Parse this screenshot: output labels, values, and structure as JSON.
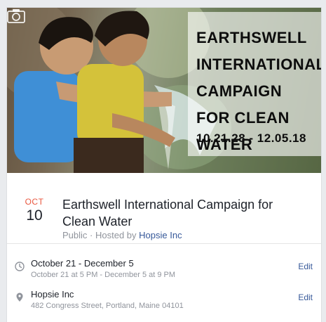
{
  "cover": {
    "poster_title": "EARTHSWELL INTERNATIONAL CAMPAIGN FOR CLEAN WATER",
    "poster_dates": "10.21.28 - 12.05.18",
    "camera_icon": "camera-icon"
  },
  "event": {
    "month": "OCT",
    "day": "10",
    "title": "Earthswell International Campaign for Clean Water",
    "privacy": "Public",
    "hosted_by_prefix": "Hosted by",
    "host": "Hopsie Inc"
  },
  "details": {
    "time": {
      "icon": "clock-icon",
      "main": "October 21 - December  5",
      "sub": "October 21 at 5 PM - December 5 at 9 PM",
      "edit": "Edit"
    },
    "location": {
      "icon": "location-pin-icon",
      "main": "Hopsie Inc",
      "sub": "482 Congress Street, Portland, Maine 04101",
      "edit": "Edit"
    }
  },
  "colors": {
    "month_accent": "#e9573f",
    "link": "#365899",
    "secondary_text": "#90949c"
  }
}
